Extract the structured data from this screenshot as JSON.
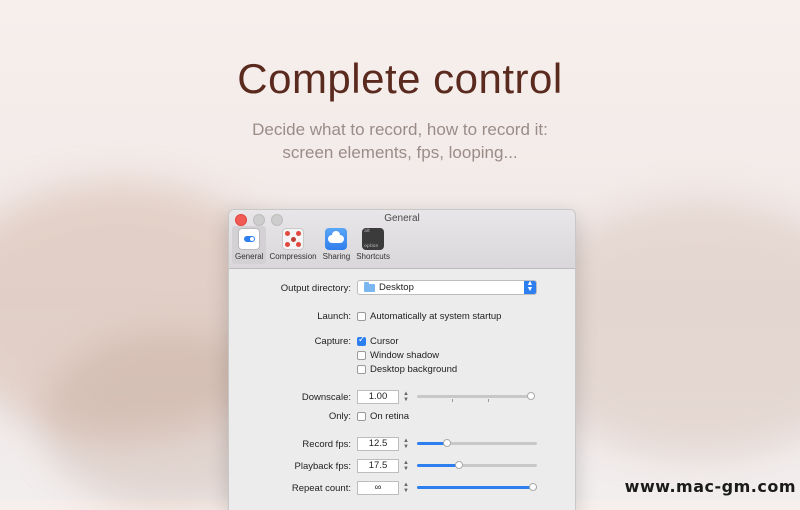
{
  "hero": {
    "title": "Complete control",
    "subtitle_line1": "Decide what to record, how to record it:",
    "subtitle_line2": "screen elements, fps, looping..."
  },
  "window": {
    "title": "General",
    "toolbar": [
      {
        "label": "General",
        "icon": "toggle-icon",
        "selected": true
      },
      {
        "label": "Compression",
        "icon": "compression-icon",
        "selected": false
      },
      {
        "label": "Sharing",
        "icon": "cloud-icon",
        "selected": false
      },
      {
        "label": "Shortcuts",
        "icon": "alt-option-key-icon",
        "selected": false,
        "key_top": "alt",
        "key_bottom": "option"
      }
    ],
    "output_directory": {
      "label": "Output directory:",
      "value": "Desktop"
    },
    "launch": {
      "label": "Launch:",
      "option": "Automatically at system startup",
      "checked": false
    },
    "capture": {
      "label": "Capture:",
      "options": [
        {
          "label": "Cursor",
          "checked": true
        },
        {
          "label": "Window shadow",
          "checked": false
        },
        {
          "label": "Desktop background",
          "checked": false
        }
      ]
    },
    "downscale": {
      "label": "Downscale:",
      "value": "1.00",
      "level": 1.0
    },
    "only": {
      "label": "Only:",
      "option": "On retina",
      "checked": false
    },
    "record_fps": {
      "label": "Record fps:",
      "value": "12.5",
      "level": 0.25
    },
    "playback_fps": {
      "label": "Playback fps:",
      "value": "17.5",
      "level": 0.35
    },
    "repeat_count": {
      "label": "Repeat count:",
      "value": "∞",
      "level": 1.0
    }
  },
  "watermark": "www.mac-gm.com",
  "colors": {
    "accent": "#2d7ff0",
    "title": "#5b2a1e",
    "subtitle": "#9b8c88"
  }
}
